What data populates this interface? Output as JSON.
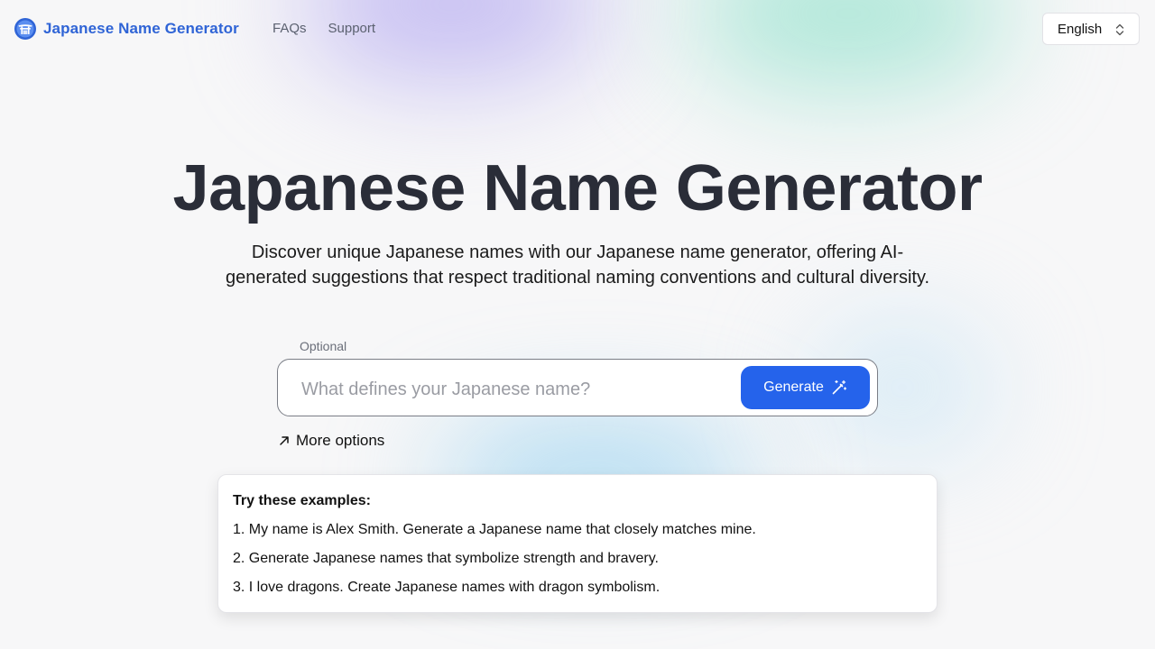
{
  "header": {
    "brand_name": "Japanese Name Generator",
    "brand_logo_icon": "torii-logo-icon",
    "nav": [
      {
        "label": "FAQs"
      },
      {
        "label": "Support"
      }
    ],
    "language": {
      "selected": "English",
      "icon": "chevron-up-down-icon"
    }
  },
  "hero": {
    "title": "Japanese Name Generator",
    "subtitle": "Discover unique Japanese names with our Japanese name generator, offering AI-generated suggestions that respect traditional naming conventions and cultural diversity."
  },
  "form": {
    "optional_label": "Optional",
    "input_value": "",
    "input_placeholder": "What defines your Japanese name?",
    "generate_label": "Generate",
    "generate_icon": "magic-wand-icon",
    "more_options_label": "More options",
    "more_options_icon": "arrow-up-right-icon"
  },
  "examples": {
    "title": "Try these examples:",
    "items": [
      "1. My name is Alex Smith. Generate a Japanese name that closely matches mine.",
      "2. Generate Japanese names that symbolize strength and bravery.",
      "3. I love dragons. Create Japanese names with dragon symbolism."
    ]
  },
  "colors": {
    "brand": "#2f64d6",
    "primary_button": "#2563eb",
    "title_text": "#2a2d38",
    "background": "#f7f7f8"
  }
}
